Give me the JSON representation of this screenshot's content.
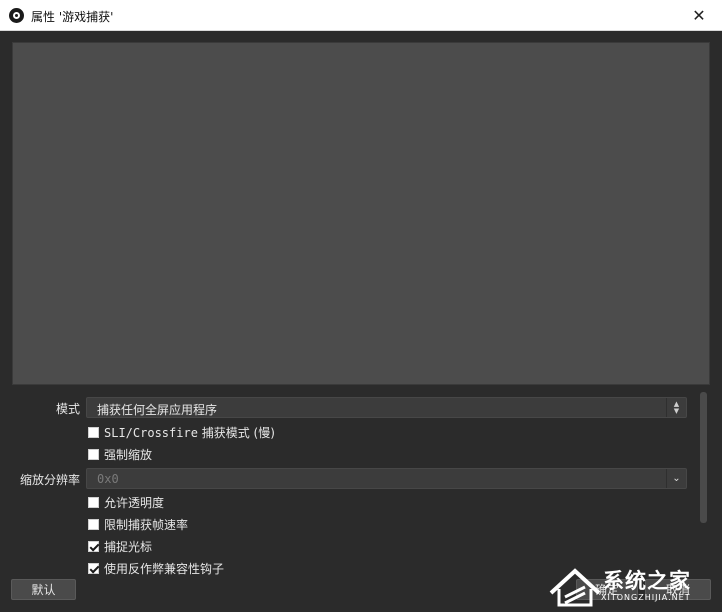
{
  "window": {
    "title": "属性 '游戏捕获'",
    "close_glyph": "✕"
  },
  "properties": {
    "mode": {
      "label": "模式",
      "value": "捕获任何全屏应用程序"
    },
    "sli_crossfire": {
      "prefix": "SLI/Crossfire",
      "suffix": " 捕获模式 (慢)",
      "checked": false
    },
    "force_scaling": {
      "label": "强制缩放",
      "checked": false
    },
    "scale_resolution": {
      "label": "缩放分辨率",
      "value": "0x0",
      "disabled": true
    },
    "allow_transparency": {
      "label": "允许透明度",
      "checked": false
    },
    "limit_capture_framerate": {
      "label": "限制捕获帧速率",
      "checked": false
    },
    "capture_cursor": {
      "label": "捕捉光标",
      "checked": true
    },
    "anti_cheat_hook": {
      "label": "使用反作弊兼容性钩子",
      "checked": true
    }
  },
  "buttons": {
    "defaults": "默认",
    "ok": "确定",
    "cancel": "取消"
  },
  "watermark": {
    "brand": "系统之家",
    "url": "XITONGZHIJIA.NET"
  },
  "icons": {
    "app": "obs-logo-icon",
    "close": "close-icon",
    "spin": "updown-arrows-icon",
    "dropdown": "chevron-down-icon",
    "check": "checkmark-icon"
  }
}
